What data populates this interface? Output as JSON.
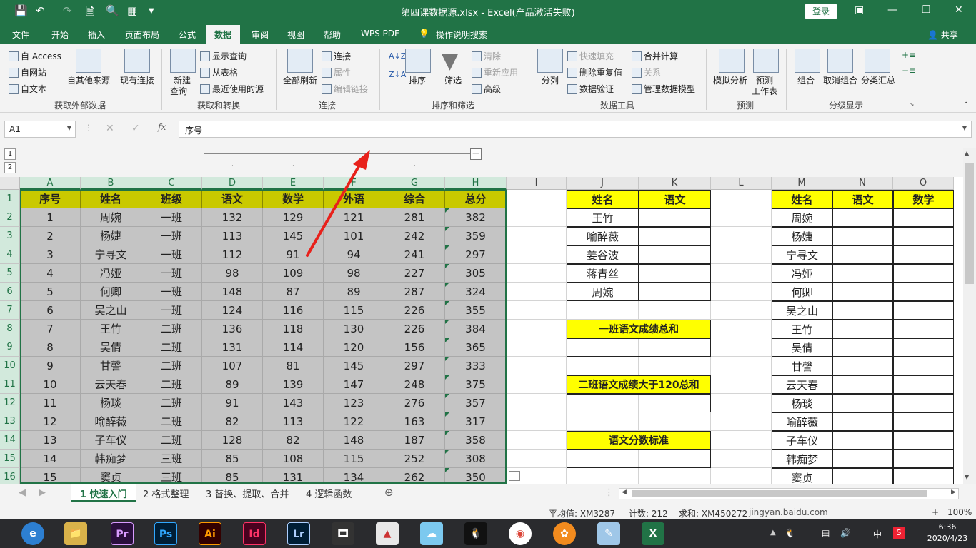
{
  "window": {
    "title": "第四课数据源.xlsx  -  Excel(产品激活失败)",
    "login": "登录"
  },
  "tabs": [
    "文件",
    "开始",
    "插入",
    "页面布局",
    "公式",
    "数据",
    "审阅",
    "视图",
    "帮助",
    "WPS PDF",
    "操作说明搜索"
  ],
  "share": "共享",
  "ribbon": {
    "g1": {
      "access": "自 Access",
      "web": "自网站",
      "text": "自文本",
      "other": "自其他来源",
      "existing": "现有连接",
      "label": "获取外部数据"
    },
    "g2": {
      "newquery": "新建",
      "newquery2": "查询",
      "show": "显示查询",
      "fromtable": "从表格",
      "recent": "最近使用的源",
      "label": "获取和转换"
    },
    "g3": {
      "refresh": "全部刷新",
      "conn": "连接",
      "props": "属性",
      "edit": "编辑链接",
      "label": "连接"
    },
    "g4": {
      "sort": "排序",
      "filter": "筛选",
      "clear": "清除",
      "reapply": "重新应用",
      "advanced": "高级",
      "label": "排序和筛选"
    },
    "g5": {
      "split": "分列",
      "flash": "快速填充",
      "dedupe": "删除重复值",
      "validate": "数据验证",
      "consolidate": "合并计算",
      "relation": "关系",
      "model": "管理数据模型",
      "label": "数据工具"
    },
    "g6": {
      "whatif": "模拟分析",
      "forecast": "预测",
      "forecast2": "工作表",
      "label": "预测"
    },
    "g7": {
      "group": "组合",
      "ungroup": "取消组合",
      "subtotal": "分类汇总",
      "label": "分级显示"
    }
  },
  "formula": {
    "cell": "A1",
    "value": "序号"
  },
  "outline": [
    "1",
    "2"
  ],
  "cols": [
    "A",
    "B",
    "C",
    "D",
    "E",
    "F",
    "G",
    "H",
    "I",
    "J",
    "K",
    "L",
    "M",
    "N",
    "O"
  ],
  "rows": [
    "1",
    "2",
    "3",
    "4",
    "5",
    "6",
    "7",
    "8",
    "9",
    "10",
    "11",
    "12",
    "13",
    "14",
    "15",
    "16"
  ],
  "table_header": [
    "序号",
    "姓名",
    "班级",
    "语文",
    "数学",
    "外语",
    "综合",
    "总分"
  ],
  "table_rows": [
    [
      "1",
      "周婉",
      "一班",
      "132",
      "129",
      "121",
      "281",
      "382"
    ],
    [
      "2",
      "杨婕",
      "一班",
      "113",
      "145",
      "101",
      "242",
      "359"
    ],
    [
      "3",
      "宁寻文",
      "一班",
      "112",
      "91",
      "94",
      "241",
      "297"
    ],
    [
      "4",
      "冯娅",
      "一班",
      "98",
      "109",
      "98",
      "227",
      "305"
    ],
    [
      "5",
      "何卿",
      "一班",
      "148",
      "87",
      "89",
      "287",
      "324"
    ],
    [
      "6",
      "吴之山",
      "一班",
      "124",
      "116",
      "115",
      "226",
      "355"
    ],
    [
      "7",
      "王竹",
      "二班",
      "136",
      "118",
      "130",
      "226",
      "384"
    ],
    [
      "8",
      "吴倩",
      "二班",
      "131",
      "114",
      "120",
      "156",
      "365"
    ],
    [
      "9",
      "甘謦",
      "二班",
      "107",
      "81",
      "145",
      "297",
      "333"
    ],
    [
      "10",
      "云天春",
      "二班",
      "89",
      "139",
      "147",
      "248",
      "375"
    ],
    [
      "11",
      "杨琰",
      "二班",
      "91",
      "143",
      "123",
      "276",
      "357"
    ],
    [
      "12",
      "喻醉薇",
      "二班",
      "82",
      "113",
      "122",
      "163",
      "317"
    ],
    [
      "13",
      "子车仪",
      "二班",
      "128",
      "82",
      "148",
      "187",
      "358"
    ],
    [
      "14",
      "韩痴梦",
      "三班",
      "85",
      "108",
      "115",
      "252",
      "308"
    ],
    [
      "15",
      "窦贞",
      "三班",
      "85",
      "131",
      "134",
      "262",
      "350"
    ]
  ],
  "jk": {
    "h1": "姓名",
    "h2": "语文",
    "names": [
      "王竹",
      "喻醉薇",
      "姜谷波",
      "蒋青丝",
      "周婉"
    ],
    "t1": "一班语文成绩总和",
    "t2": "二班语文成绩大于120总和",
    "t3": "语文分数标准"
  },
  "mno": {
    "h1": "姓名",
    "h2": "语文",
    "h3": "数学",
    "names": [
      "周婉",
      "杨婕",
      "宁寻文",
      "冯娅",
      "何卿",
      "吴之山",
      "王竹",
      "吴倩",
      "甘謦",
      "云天春",
      "杨琰",
      "喻醉薇",
      "子车仪",
      "韩痴梦",
      "窦贞"
    ]
  },
  "sheets": [
    "1 快速入门",
    "2 格式整理",
    "3 替换、提取、合并",
    "4 逻辑函数"
  ],
  "status": {
    "avg": "平均值: XM3287",
    "count": "计数: 212",
    "sum": "求和: XM450272",
    "zoom": "100%"
  },
  "watermark": "jingyan.baidu.com",
  "taskbar": {
    "apps": [
      "Pr",
      "Ps",
      "Ai",
      "Id",
      "Lr"
    ],
    "time": "6:36",
    "date": "2020/4/23",
    "ime": "中"
  },
  "colors": {
    "accent": "#217346",
    "highlight": "#ffff00",
    "selection": "#c4c4c4"
  }
}
